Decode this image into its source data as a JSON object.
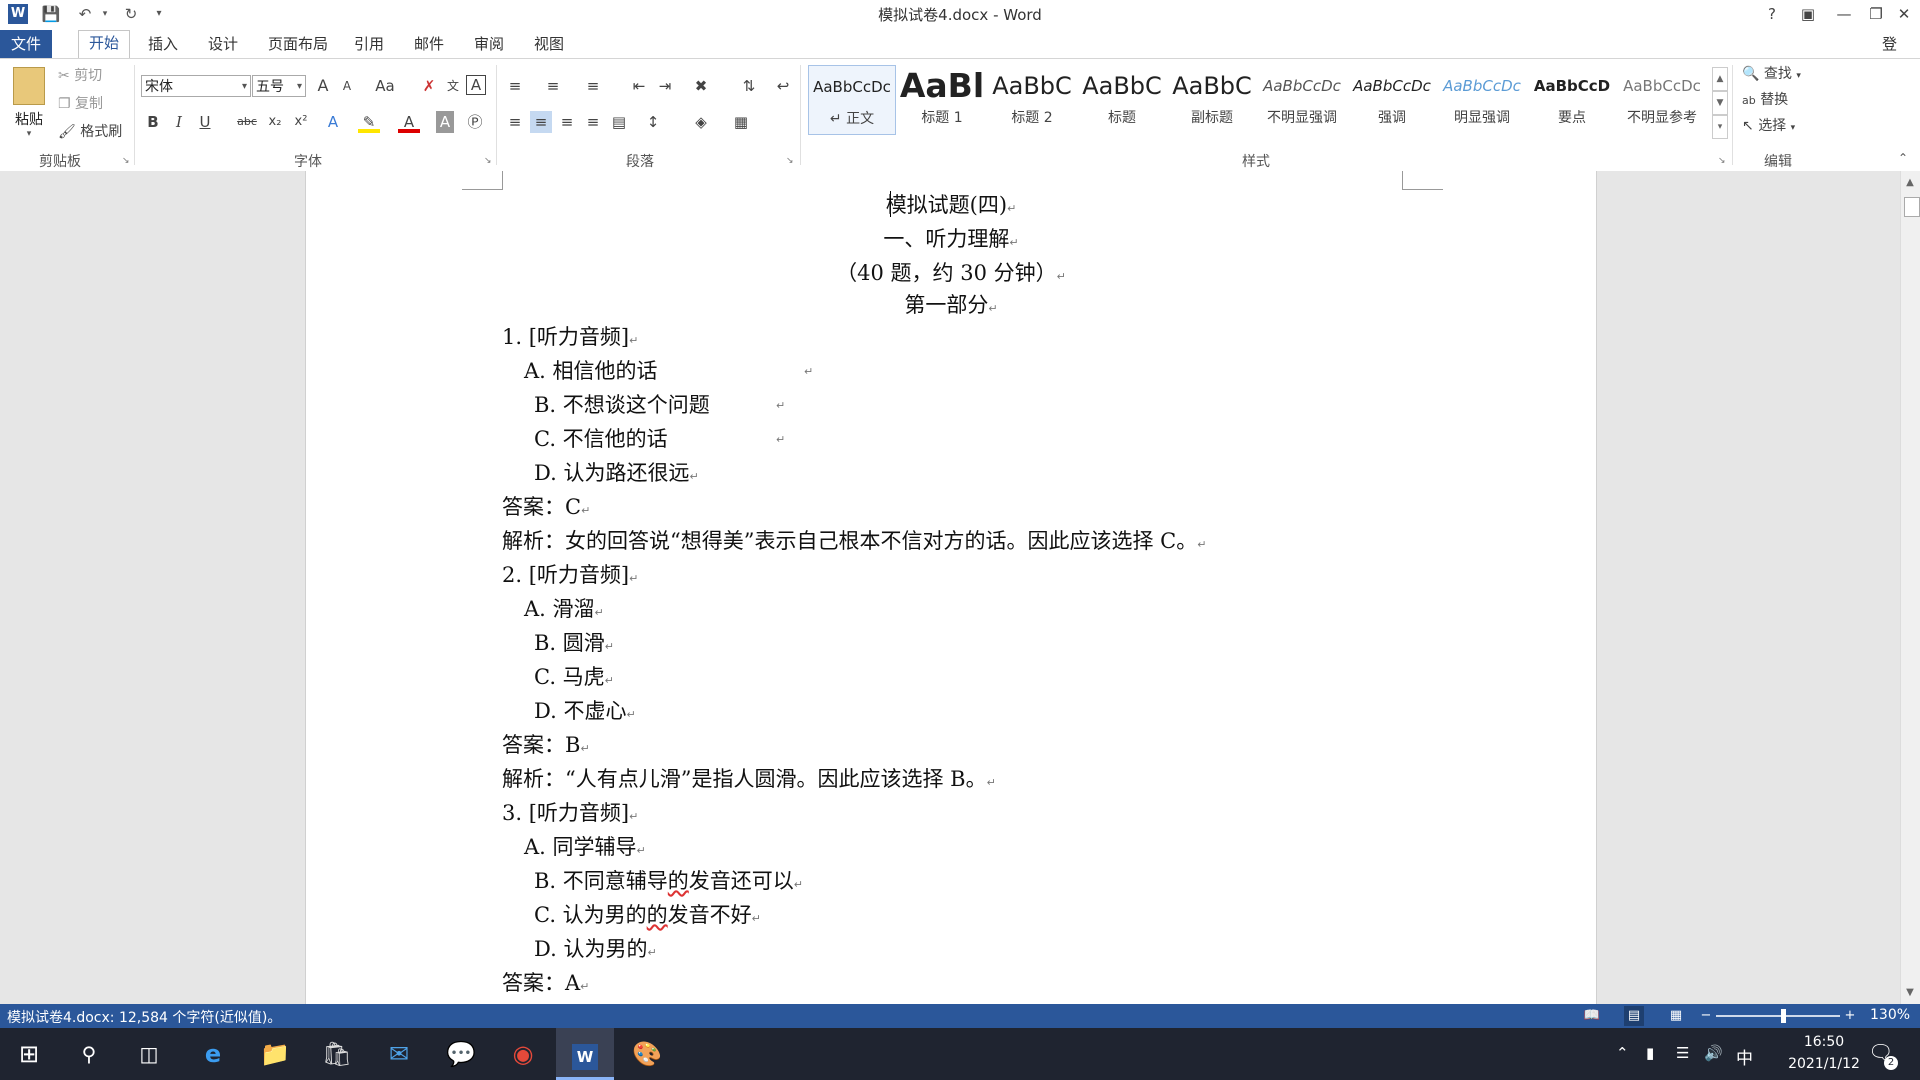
{
  "window": {
    "title": "模拟试卷4.docx - Word",
    "help": "?",
    "login": "登录"
  },
  "tabs": [
    "文件",
    "开始",
    "插入",
    "设计",
    "页面布局",
    "引用",
    "邮件",
    "审阅",
    "视图"
  ],
  "ribbon": {
    "clipboard": {
      "paste": "粘贴",
      "cut": "剪切",
      "copy": "复制",
      "format_painter": "格式刷",
      "label": "剪贴板"
    },
    "font": {
      "name": "宋体",
      "size": "五号",
      "label": "字体",
      "grow": "A",
      "shrink": "A",
      "case": "Aa",
      "bold": "B",
      "italic": "I",
      "underline": "U",
      "strike": "abc",
      "sub": "x₂",
      "sup": "x²"
    },
    "paragraph": {
      "label": "段落"
    },
    "styles": {
      "label": "样式",
      "items": [
        {
          "preview": "AaBbCcDc",
          "name": "正文",
          "selected": true
        },
        {
          "preview": "AaBl",
          "name": "标题 1"
        },
        {
          "preview": "AaBbC",
          "name": "标题 2"
        },
        {
          "preview": "AaBbC",
          "name": "标题"
        },
        {
          "preview": "AaBbC",
          "name": "副标题"
        },
        {
          "preview": "AaBbCcDc",
          "name": "不明显强调"
        },
        {
          "preview": "AaBbCcDc",
          "name": "强调"
        },
        {
          "preview": "AaBbCcDc",
          "name": "明显强调"
        },
        {
          "preview": "AaBbCcD",
          "name": "要点"
        },
        {
          "preview": "AaBbCcDc",
          "name": "不明显参考"
        }
      ]
    },
    "editing": {
      "find": "查找",
      "replace": "替换",
      "select": "选择",
      "label": "编辑"
    }
  },
  "document": {
    "lines": [
      "模拟试题(四)",
      "一、听力理解",
      "（40 题，约 30 分钟）",
      "第一部分",
      "1.   [听力音频]",
      "A.  相信他的话",
      "B.  不想谈这个问题",
      "C.  不信他的话",
      "D.  认为路还很远",
      "答案：C",
      "解析：女的回答说“想得美”表示自己根本不信对方的话。因此应该选择 C。",
      "2.   [听力音频]",
      "A.  滑溜",
      "B.  圆滑",
      "C.  马虎",
      "D.  不虚心",
      "答案：B",
      "解析：“人有点儿滑”是指人圆滑。因此应该选择 B。",
      "3.   [听力音频]",
      "A.  同学辅导",
      "B.  不同意辅导",
      "C.  认为男的",
      "D.  认为男的",
      "答案：A"
    ],
    "squiggle_word": "的",
    "line3_tail": "发音还可以",
    "line4_tail": "发音不好",
    "para_mark": "↵"
  },
  "status": {
    "text": "模拟试卷4.docx: 12,584 个字符(近似值)。",
    "zoom": "130%",
    "zoom_level_percent": 130
  },
  "taskbar": {
    "ime": "中",
    "time": "16:50",
    "date": "2021/1/12",
    "notifications": "2"
  },
  "colors": {
    "accent": "#2b579a",
    "taskbar": "#1f2430"
  }
}
